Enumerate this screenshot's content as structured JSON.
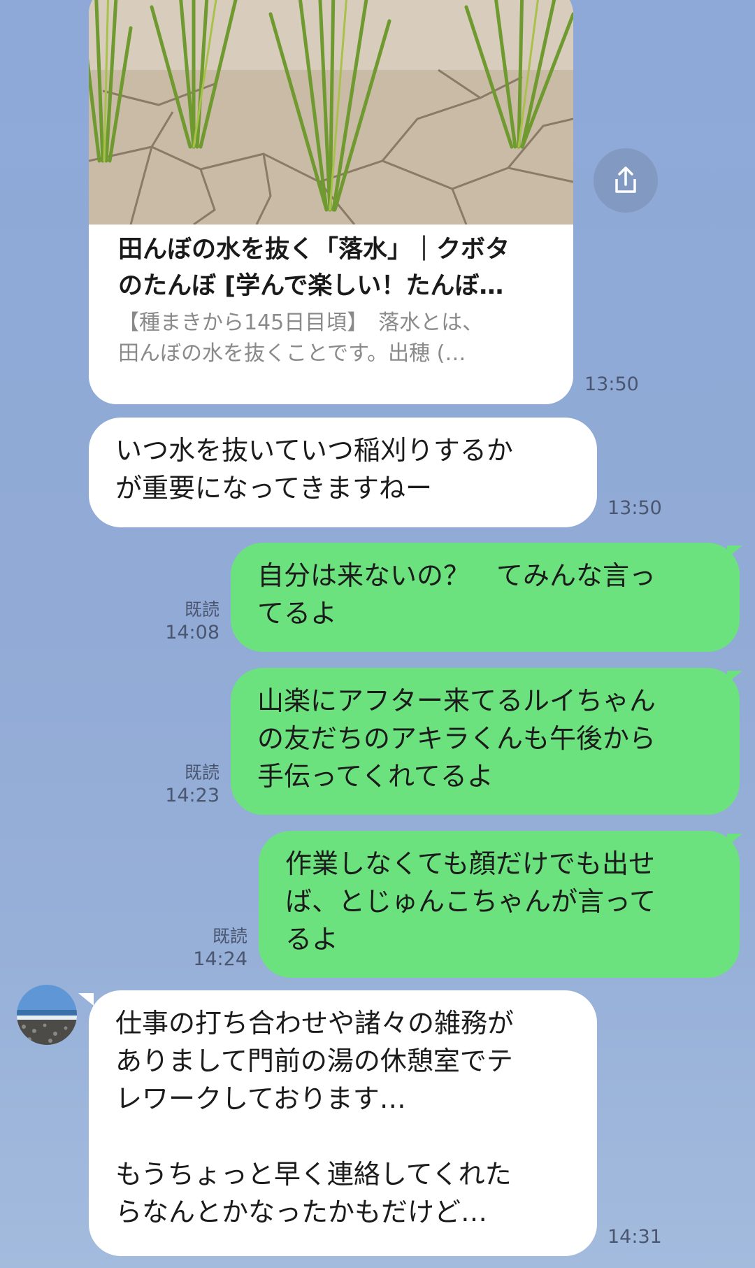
{
  "link_card": {
    "title_lines": [
      "田んぼの水を抜く「落水」｜クボタ",
      "のたんぼ [学んで楽しい！たんぼ…"
    ],
    "desc_lines": [
      "【種まきから145日目頃】　落水とは、",
      "田んぼの水を抜くことです。出穂 (…"
    ],
    "time": "13:50",
    "share_icon": "share-icon"
  },
  "messages": [
    {
      "side": "incoming",
      "lines": [
        "いつ水を抜いていつ稲刈りするか",
        "が重要になってきますねー"
      ],
      "time": "13:50"
    },
    {
      "side": "outgoing",
      "lines": [
        "自分は来ないの？　てみんな言っ",
        "てるよ"
      ],
      "read": "既読",
      "time": "14:08"
    },
    {
      "side": "outgoing",
      "lines": [
        "山楽にアフター来てるルイちゃん",
        "の友だちのアキラくんも午後から",
        "手伝ってくれてるよ"
      ],
      "read": "既読",
      "time": "14:23"
    },
    {
      "side": "outgoing",
      "lines": [
        "作業しなくても顔だけでも出せ",
        "ば、とじゅんこちゃんが言って",
        "るよ"
      ],
      "read": "既読",
      "time": "14:24"
    },
    {
      "side": "incoming",
      "lines": [
        "仕事の打ち合わせや諸々の雑務が",
        "ありまして門前の湯の休憩室でテ",
        "レワークしております…",
        "",
        "もうちょっと早く連絡してくれた",
        "らなんとかなったかもだけど…"
      ],
      "time": "14:31",
      "avatar": "beach-avatar"
    }
  ],
  "colors": {
    "background": "#8ea9d8",
    "outgoing_bubble": "#6ce27f",
    "incoming_bubble": "#ffffff"
  }
}
